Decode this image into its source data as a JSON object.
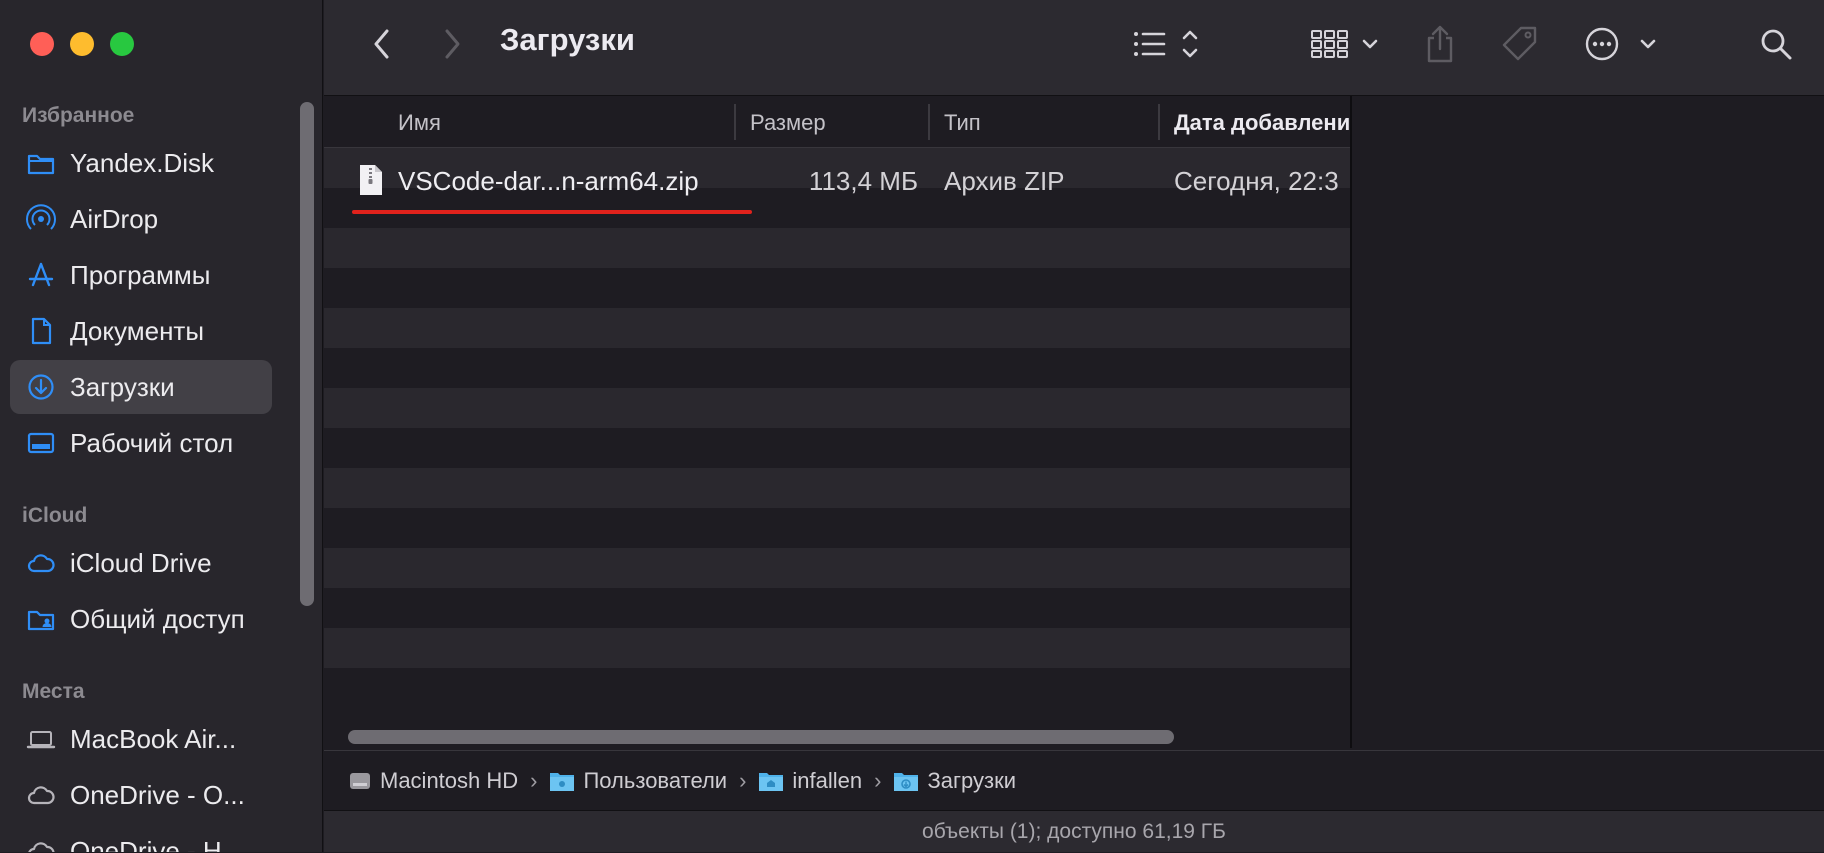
{
  "sidebar": {
    "sections": [
      {
        "title": "Избранное"
      },
      {
        "title": "iCloud"
      },
      {
        "title": "Места"
      }
    ],
    "favorites": [
      {
        "label": "Yandex.Disk",
        "icon": "folder-icon"
      },
      {
        "label": "AirDrop",
        "icon": "airdrop-icon"
      },
      {
        "label": "Программы",
        "icon": "applications-icon"
      },
      {
        "label": "Документы",
        "icon": "document-icon"
      },
      {
        "label": "Загрузки",
        "icon": "downloads-icon",
        "active": true
      },
      {
        "label": "Рабочий стол",
        "icon": "desktop-icon"
      }
    ],
    "icloud": [
      {
        "label": "iCloud Drive",
        "icon": "cloud-icon"
      },
      {
        "label": "Общий доступ",
        "icon": "shared-folder-icon"
      }
    ],
    "places": [
      {
        "label": "MacBook Air...",
        "icon": "laptop-icon"
      },
      {
        "label": "OneDrive - O...",
        "icon": "cloud-icon"
      },
      {
        "label": "OneDrive - H...",
        "icon": "cloud-icon"
      }
    ]
  },
  "toolbar": {
    "title": "Загрузки"
  },
  "columns": {
    "name": "Имя",
    "size": "Размер",
    "type": "Тип",
    "date": "Дата добавлени"
  },
  "files": [
    {
      "name": "VSCode-dar...n-arm64.zip",
      "size": "113,4 МБ",
      "type": "Архив ZIP",
      "date": "Сегодня, 22:3"
    }
  ],
  "path": [
    "Macintosh HD",
    "Пользователи",
    "infallen",
    "Загрузки"
  ],
  "status": "объекты (1); доступно 61,19 ГБ",
  "colors": {
    "accent": "#2f8ef7",
    "highlight_underline": "#e0221c"
  }
}
